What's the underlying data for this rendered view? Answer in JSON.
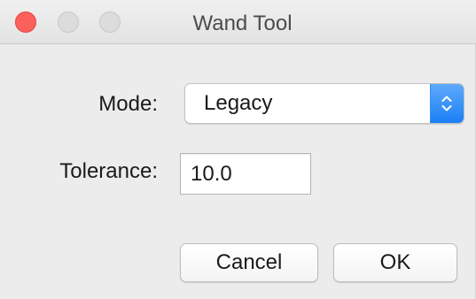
{
  "window": {
    "title": "Wand Tool"
  },
  "form": {
    "mode_label": "Mode:",
    "mode_value": "Legacy",
    "tolerance_label": "Tolerance:",
    "tolerance_value": "10.0"
  },
  "buttons": {
    "cancel_label": "Cancel",
    "ok_label": "OK"
  },
  "colors": {
    "close": "#fc605c",
    "accent": "#1c7ff6",
    "background": "#ececec"
  },
  "icons": {
    "close": "close-icon",
    "minimize": "minimize-icon",
    "zoom": "zoom-icon",
    "select_arrows": "up-down-chevron-icon"
  }
}
